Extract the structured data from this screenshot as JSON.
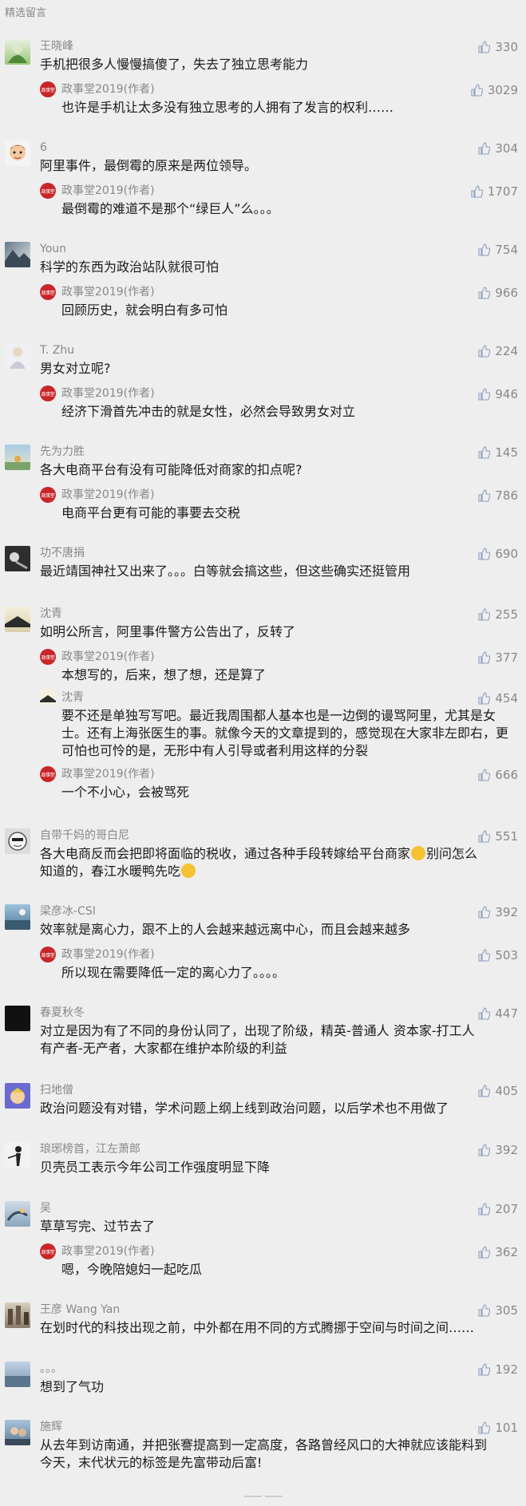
{
  "section_title": "精选留言",
  "comments": [
    {
      "nickname": "王晓峰",
      "text": "手机把很多人慢慢搞傻了，失去了独立思考能力",
      "likes": "330",
      "replies": [
        {
          "nickname": "政事堂2019(作者)",
          "text": "也许是手机让太多没有独立思考的人拥有了发言的权利……",
          "likes": "3029"
        }
      ]
    },
    {
      "nickname": "6",
      "text": "阿里事件，最倒霉的原来是两位领导。",
      "likes": "304",
      "replies": [
        {
          "nickname": "政事堂2019(作者)",
          "text": "最倒霉的难道不是那个“绿巨人”么。。。",
          "likes": "1707"
        }
      ]
    },
    {
      "nickname": "Youn",
      "text": "科学的东西为政治站队就很可怕",
      "likes": "754",
      "replies": [
        {
          "nickname": "政事堂2019(作者)",
          "text": "回顾历史，就会明白有多可怕",
          "likes": "966"
        }
      ]
    },
    {
      "nickname": "T. Zhu",
      "text": "男女对立呢?",
      "likes": "224",
      "replies": [
        {
          "nickname": "政事堂2019(作者)",
          "text": "经济下滑首先冲击的就是女性，必然会导致男女对立",
          "likes": "946"
        }
      ]
    },
    {
      "nickname": "先为力胜",
      "text": "各大电商平台有没有可能降低对商家的扣点呢?",
      "likes": "145",
      "replies": [
        {
          "nickname": "政事堂2019(作者)",
          "text": "电商平台更有可能的事要去交税",
          "likes": "786"
        }
      ]
    },
    {
      "nickname": "功不唐捐",
      "text": "最近靖国神社又出来了。。。白等就会搞这些，但这些确实还挺管用",
      "likes": "690",
      "replies": []
    },
    {
      "nickname": "沈青",
      "text": "如明公所言，阿里事件警方公告出了，反转了",
      "likes": "255",
      "replies": [
        {
          "nickname": "政事堂2019(作者)",
          "text": "本想写的，后来，想了想，还是算了",
          "likes": "377"
        },
        {
          "nickname": "沈青",
          "text": "要不还是单独写写吧。最近我周围都人基本也是一边倒的谩骂阿里，尤其是女士。还有上海张医生的事。就像今天的文章提到的，感觉现在大家非左即右，更可怕也可怜的是，无形中有人引导或者利用这样的分裂",
          "likes": "454"
        },
        {
          "nickname": "政事堂2019(作者)",
          "text": "一个不小心，会被骂死",
          "likes": "666"
        }
      ]
    },
    {
      "nickname": "自带千妈的哥白尼",
      "text": "各大电商反而会把即将面临的税收，通过各种手段转嫁给平台商家",
      "text2": "别问怎么知道的，春江水暖鸭先吃",
      "likes": "551",
      "replies": []
    },
    {
      "nickname": "梁彦冰-CSI",
      "text": "效率就是离心力，跟不上的人会越来越远离中心，而且会越来越多",
      "likes": "392",
      "replies": [
        {
          "nickname": "政事堂2019(作者)",
          "text": "所以现在需要降低一定的离心力了。。。。",
          "likes": "503"
        }
      ]
    },
    {
      "nickname": "春夏秋冬",
      "text": "对立是因为有了不同的身份认同了，出现了阶级，精英-普通人 资本家-打工人 有产者-无产者，大家都在维护本阶级的利益",
      "likes": "447",
      "replies": []
    },
    {
      "nickname": "扫地僧",
      "text": "政治问题没有对错，学术问题上纲上线到政治问题，以后学术也不用做了",
      "likes": "405",
      "replies": []
    },
    {
      "nickname": "琅琊榜首，江左萧郎",
      "text": "贝壳员工表示今年公司工作强度明显下降",
      "likes": "392",
      "replies": []
    },
    {
      "nickname": "吴",
      "text": "草草写完、过节去了",
      "likes": "207",
      "replies": [
        {
          "nickname": "政事堂2019(作者)",
          "text": "嗯，今晚陪媳妇一起吃瓜",
          "likes": "362"
        }
      ]
    },
    {
      "nickname": "王彦 Wang Yan",
      "text": "在划时代的科技出现之前，中外都在用不同的方式腾挪于空间与时间之间……",
      "likes": "305",
      "replies": []
    },
    {
      "nickname": "。。。",
      "text": "想到了气功",
      "likes": "192",
      "replies": []
    },
    {
      "nickname": "施辉",
      "text": "从去年到访南通，并把张謇提高到一定高度，各路曾经风口的大神就应该能料到今天，末代状元的标签是先富带动后富!",
      "likes": "101",
      "replies": []
    }
  ],
  "author_badge": "政事堂",
  "colors": {
    "author_red": "#c8262a",
    "muted": "#888888",
    "background": "#eeeeee"
  }
}
